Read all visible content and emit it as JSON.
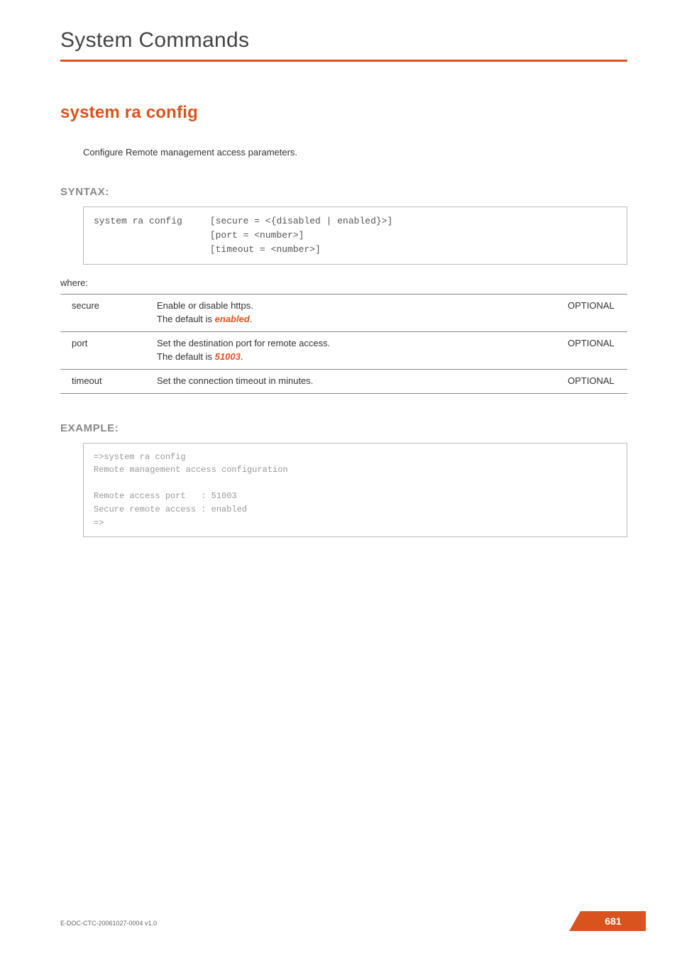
{
  "header": {
    "chapter_title": "System Commands"
  },
  "command": {
    "title": "system ra config",
    "description": "Configure Remote management access parameters."
  },
  "syntax": {
    "heading": "SYNTAX:",
    "code": "system ra config     [secure = <{disabled | enabled}>]\n                     [port = <number>]\n                     [timeout = <number>]"
  },
  "where_label": "where:",
  "params": [
    {
      "name": "secure",
      "desc_pre": "Enable or disable https.\nThe default is ",
      "desc_emph": "enabled",
      "desc_post": ".",
      "kind": "OPTIONAL"
    },
    {
      "name": "port",
      "desc_pre": "Set the destination port for remote access.\nThe default is ",
      "desc_emph": "51003",
      "desc_post": ".",
      "kind": "OPTIONAL"
    },
    {
      "name": "timeout",
      "desc_pre": "Set the connection timeout in minutes.",
      "desc_emph": "",
      "desc_post": "",
      "kind": "OPTIONAL"
    }
  ],
  "example": {
    "heading": "EXAMPLE:",
    "code": "=>system ra config\nRemote management access configuration\n\nRemote access port   : 51003\nSecure remote access : enabled\n=>"
  },
  "footer": {
    "doc_id": "E-DOC-CTC-20061027-0004 v1.0",
    "page_number": "681"
  }
}
